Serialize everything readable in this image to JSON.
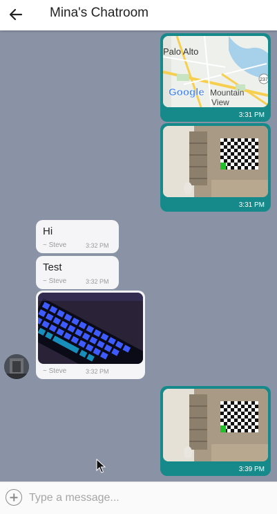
{
  "header": {
    "title": "Mina's Chatroom"
  },
  "map": {
    "labels": [
      "Palo Alto",
      "Google",
      "Mountain",
      "View"
    ],
    "road_badge": "237"
  },
  "messages": [
    {
      "direction": "out",
      "type": "map",
      "time": "3:31 PM"
    },
    {
      "direction": "out",
      "type": "image",
      "time": "3:31 PM"
    },
    {
      "direction": "in",
      "type": "text",
      "text": "Hi",
      "sender": "~ Steve",
      "time": "3:32 PM"
    },
    {
      "direction": "in",
      "type": "text",
      "text": "Test",
      "sender": "~ Steve",
      "time": "3:32 PM"
    },
    {
      "direction": "in",
      "type": "image",
      "sender": "~ Steve",
      "time": "3:32 PM"
    },
    {
      "direction": "out",
      "type": "image",
      "time": "3:39 PM"
    }
  ],
  "composer": {
    "placeholder": "Type a message..."
  },
  "icons": {
    "back": "arrow-left-icon",
    "add": "plus-circle-icon"
  },
  "colors": {
    "outgoing_bubble": "#168a8a",
    "incoming_bubble": "#f5f5f7",
    "chat_bg": "#8a93a6"
  }
}
